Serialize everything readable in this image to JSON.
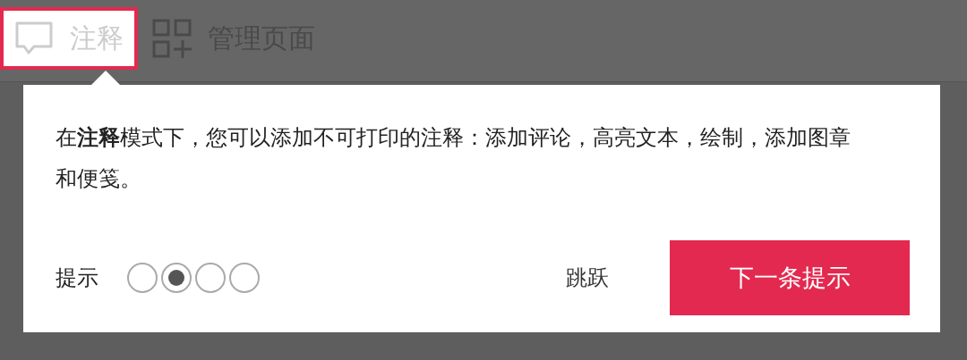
{
  "toolbar": [
    {
      "label": "注释",
      "selected": true,
      "kind": "comment"
    },
    {
      "label": "管理页面",
      "selected": false,
      "kind": "pages"
    }
  ],
  "popup": {
    "message": "在**注释**模式下，您可以添加不可打印的注释：添加评论，高亮文本，绘制，添加图章和便笺。",
    "hint_label": "提示",
    "steps": [
      {
        "selected": false
      },
      {
        "selected": true
      },
      {
        "selected": false
      },
      {
        "selected": false
      }
    ],
    "skip": "跳跃",
    "next": "下一条提示"
  }
}
